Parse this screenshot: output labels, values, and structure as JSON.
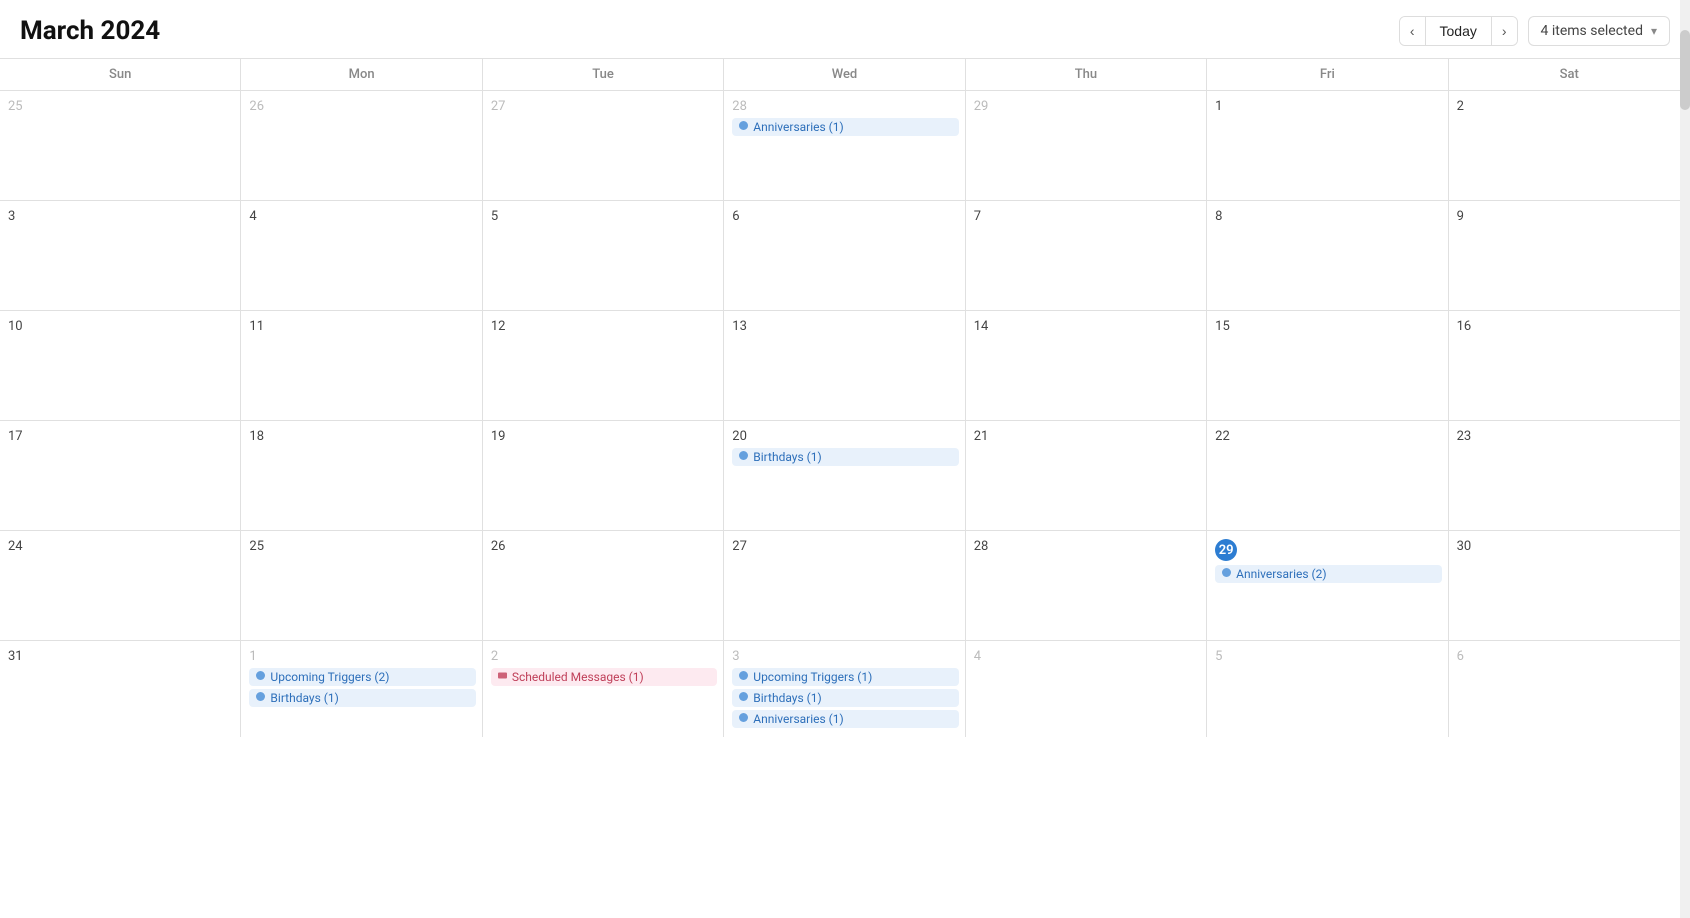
{
  "header": {
    "title": "March 2024",
    "today_label": "Today",
    "filter_label": "4 items selected",
    "chevron_left": "‹",
    "chevron_right": "›",
    "chevron_down": "▾"
  },
  "day_headers": [
    "Sun",
    "Mon",
    "Tue",
    "Wed",
    "Thu",
    "Fri",
    "Sat"
  ],
  "weeks": [
    {
      "days": [
        {
          "number": "25",
          "other_month": true,
          "events": []
        },
        {
          "number": "26",
          "other_month": true,
          "events": []
        },
        {
          "number": "27",
          "other_month": true,
          "events": []
        },
        {
          "number": "28",
          "other_month": true,
          "events": [
            {
              "label": "Anniversaries (1)",
              "type": "blue-light",
              "icon": "🎊"
            }
          ]
        },
        {
          "number": "29",
          "other_month": true,
          "events": []
        },
        {
          "number": "1",
          "events": []
        },
        {
          "number": "2",
          "events": []
        }
      ]
    },
    {
      "days": [
        {
          "number": "3",
          "events": []
        },
        {
          "number": "4",
          "events": []
        },
        {
          "number": "5",
          "events": []
        },
        {
          "number": "6",
          "events": []
        },
        {
          "number": "7",
          "events": []
        },
        {
          "number": "8",
          "events": []
        },
        {
          "number": "9",
          "events": []
        }
      ]
    },
    {
      "days": [
        {
          "number": "10",
          "events": []
        },
        {
          "number": "11",
          "events": []
        },
        {
          "number": "12",
          "events": []
        },
        {
          "number": "13",
          "events": []
        },
        {
          "number": "14",
          "events": []
        },
        {
          "number": "15",
          "events": []
        },
        {
          "number": "16",
          "events": []
        }
      ]
    },
    {
      "days": [
        {
          "number": "17",
          "events": []
        },
        {
          "number": "18",
          "events": []
        },
        {
          "number": "19",
          "events": []
        },
        {
          "number": "20",
          "events": [
            {
              "label": "Birthdays (1)",
              "type": "blue-light",
              "icon": "🎂"
            }
          ]
        },
        {
          "number": "21",
          "events": []
        },
        {
          "number": "22",
          "events": []
        },
        {
          "number": "23",
          "events": []
        }
      ]
    },
    {
      "days": [
        {
          "number": "24",
          "events": []
        },
        {
          "number": "25",
          "events": []
        },
        {
          "number": "26",
          "events": []
        },
        {
          "number": "27",
          "events": []
        },
        {
          "number": "28",
          "events": []
        },
        {
          "number": "29",
          "today": true,
          "events": [
            {
              "label": "Anniversaries (2)",
              "type": "blue-light",
              "icon": "🎊"
            }
          ]
        },
        {
          "number": "30",
          "events": []
        }
      ]
    },
    {
      "days": [
        {
          "number": "31",
          "events": []
        },
        {
          "number": "1",
          "other_month": true,
          "events": [
            {
              "label": "Upcoming Triggers (2)",
              "type": "blue-light",
              "icon": "⚡"
            },
            {
              "label": "Birthdays (1)",
              "type": "blue-light",
              "icon": "🎂"
            }
          ]
        },
        {
          "number": "2",
          "other_month": true,
          "events": [
            {
              "label": "Scheduled Messages (1)",
              "type": "pink-light",
              "icon": "✉"
            }
          ]
        },
        {
          "number": "3",
          "other_month": true,
          "events": [
            {
              "label": "Upcoming Triggers (1)",
              "type": "blue-light",
              "icon": "⚡"
            },
            {
              "label": "Birthdays (1)",
              "type": "blue-light",
              "icon": "🎂"
            },
            {
              "label": "Anniversaries (1)",
              "type": "blue-light",
              "icon": "🎊"
            }
          ]
        },
        {
          "number": "4",
          "other_month": true,
          "events": []
        },
        {
          "number": "5",
          "other_month": true,
          "events": []
        },
        {
          "number": "6",
          "other_month": true,
          "events": []
        }
      ]
    }
  ]
}
